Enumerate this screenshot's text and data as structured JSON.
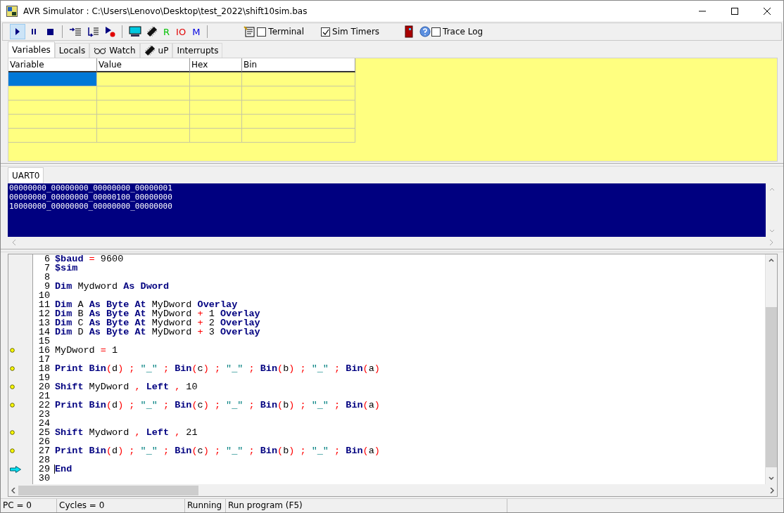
{
  "window": {
    "title": "AVR Simulator : C:\\Users\\Lenovo\\Desktop\\test_2022\\shift10sim.bas"
  },
  "toolbar": {
    "run_selected": true,
    "text_buttons": [
      {
        "label": "R",
        "color": "#00c000"
      },
      {
        "label": "IO",
        "color": "#e00000"
      },
      {
        "label": "M",
        "color": "#0000e0"
      }
    ],
    "checkboxes": [
      {
        "label": "Terminal",
        "checked": false
      },
      {
        "label": "Sim Timers",
        "checked": true
      },
      {
        "label": "Trace Log",
        "checked": false
      }
    ]
  },
  "tabs": [
    {
      "label": "Variables",
      "selected": true,
      "kind": "plain"
    },
    {
      "label": "Locals",
      "selected": false,
      "kind": "plain"
    },
    {
      "label": "Watch",
      "selected": false,
      "kind": "glasses"
    },
    {
      "label": "uP",
      "selected": false,
      "kind": "chip"
    },
    {
      "label": "Interrupts",
      "selected": false,
      "kind": "plain"
    }
  ],
  "variables_table": {
    "columns": [
      "Variable",
      "Value",
      "Hex",
      "Bin"
    ],
    "rows": [
      {
        "selected": true
      },
      {
        "selected": false
      },
      {
        "selected": false
      },
      {
        "selected": false
      },
      {
        "selected": false
      }
    ]
  },
  "uart_tabs": [
    {
      "label": "UART0",
      "selected": true
    }
  ],
  "uart_output": [
    "00000000_00000000_00000000_00000001",
    "00000000_00000000_00000100_00000000",
    "10000000_00000000_00000000_00000000"
  ],
  "code_lines": [
    {
      "number": "6",
      "kind": "plain",
      "tokens": [
        {
          "kind": "kw",
          "text": "$baud"
        },
        {
          "kind": "op",
          "text": " = "
        },
        {
          "kind": "id",
          "text": "9600"
        }
      ]
    },
    {
      "number": "7",
      "kind": "plain",
      "tokens": [
        {
          "kind": "kw",
          "text": "$sim"
        }
      ]
    },
    {
      "number": "8",
      "kind": "plain"
    },
    {
      "number": "9",
      "kind": "plain",
      "tokens": [
        {
          "kind": "kw",
          "text": "Dim"
        },
        {
          "kind": "id",
          "text": " Mydword "
        },
        {
          "kind": "kw",
          "text": "As Dword"
        }
      ]
    },
    {
      "number": "10",
      "kind": "plain"
    },
    {
      "number": "11",
      "kind": "plain",
      "tokens": [
        {
          "kind": "kw",
          "text": "Dim"
        },
        {
          "kind": "id",
          "text": " A "
        },
        {
          "kind": "kw",
          "text": "As Byte At"
        },
        {
          "kind": "id",
          "text": " MyDword "
        },
        {
          "kind": "kw",
          "text": "Overlay"
        }
      ]
    },
    {
      "number": "12",
      "kind": "plain",
      "tokens": [
        {
          "kind": "kw",
          "text": "Dim"
        },
        {
          "kind": "id",
          "text": " B "
        },
        {
          "kind": "kw",
          "text": "As Byte At"
        },
        {
          "kind": "id",
          "text": " MyDword "
        },
        {
          "kind": "op",
          "text": "+"
        },
        {
          "kind": "id",
          "text": " 1 "
        },
        {
          "kind": "kw",
          "text": "Overlay"
        }
      ]
    },
    {
      "number": "13",
      "kind": "plain",
      "tokens": [
        {
          "kind": "kw",
          "text": "Dim"
        },
        {
          "kind": "id",
          "text": " C "
        },
        {
          "kind": "kw",
          "text": "As Byte At"
        },
        {
          "kind": "id",
          "text": " Mydword "
        },
        {
          "kind": "op",
          "text": "+"
        },
        {
          "kind": "id",
          "text": " 2 "
        },
        {
          "kind": "kw",
          "text": "Overlay"
        }
      ]
    },
    {
      "number": "14",
      "kind": "plain",
      "tokens": [
        {
          "kind": "kw",
          "text": "Dim"
        },
        {
          "kind": "id",
          "text": " D "
        },
        {
          "kind": "kw",
          "text": "As Byte At"
        },
        {
          "kind": "id",
          "text": " MyDword "
        },
        {
          "kind": "op",
          "text": "+"
        },
        {
          "kind": "id",
          "text": " 3 "
        },
        {
          "kind": "kw",
          "text": "Overlay"
        }
      ]
    },
    {
      "number": "15",
      "kind": "plain"
    },
    {
      "number": "16",
      "kind": "dot",
      "tokens": [
        {
          "kind": "id",
          "text": "MyDword"
        },
        {
          "kind": "op",
          "text": " = "
        },
        {
          "kind": "id",
          "text": "1"
        }
      ]
    },
    {
      "number": "17",
      "kind": "plain"
    },
    {
      "number": "18",
      "kind": "dot",
      "tokens": [
        {
          "kind": "kw",
          "text": "Print Bin"
        },
        {
          "kind": "op",
          "text": "("
        },
        {
          "kind": "id",
          "text": "d"
        },
        {
          "kind": "op",
          "text": ") ; "
        },
        {
          "kind": "str",
          "text": "\"_\""
        },
        {
          "kind": "op",
          "text": " ; "
        },
        {
          "kind": "kw",
          "text": "Bin"
        },
        {
          "kind": "op",
          "text": "("
        },
        {
          "kind": "id",
          "text": "c"
        },
        {
          "kind": "op",
          "text": ") ; "
        },
        {
          "kind": "str",
          "text": "\"_\""
        },
        {
          "kind": "op",
          "text": " ; "
        },
        {
          "kind": "kw",
          "text": "Bin"
        },
        {
          "kind": "op",
          "text": "("
        },
        {
          "kind": "id",
          "text": "b"
        },
        {
          "kind": "op",
          "text": ") ; "
        },
        {
          "kind": "str",
          "text": "\"_\""
        },
        {
          "kind": "op",
          "text": " ; "
        },
        {
          "kind": "kw",
          "text": "Bin"
        },
        {
          "kind": "op",
          "text": "("
        },
        {
          "kind": "id",
          "text": "a"
        },
        {
          "kind": "op",
          "text": ")"
        }
      ]
    },
    {
      "number": "19",
      "kind": "plain"
    },
    {
      "number": "20",
      "kind": "dot",
      "tokens": [
        {
          "kind": "kw",
          "text": "Shift"
        },
        {
          "kind": "id",
          "text": " MyDword "
        },
        {
          "kind": "op",
          "text": ", "
        },
        {
          "kind": "kw",
          "text": "Left"
        },
        {
          "kind": "op",
          "text": " , "
        },
        {
          "kind": "id",
          "text": "10"
        }
      ]
    },
    {
      "number": "21",
      "kind": "plain"
    },
    {
      "number": "22",
      "kind": "dot",
      "tokens": [
        {
          "kind": "kw",
          "text": "Print Bin"
        },
        {
          "kind": "op",
          "text": "("
        },
        {
          "kind": "id",
          "text": "d"
        },
        {
          "kind": "op",
          "text": ") ; "
        },
        {
          "kind": "str",
          "text": "\"_\""
        },
        {
          "kind": "op",
          "text": " ; "
        },
        {
          "kind": "kw",
          "text": "Bin"
        },
        {
          "kind": "op",
          "text": "("
        },
        {
          "kind": "id",
          "text": "c"
        },
        {
          "kind": "op",
          "text": ") ; "
        },
        {
          "kind": "str",
          "text": "\"_\""
        },
        {
          "kind": "op",
          "text": " ; "
        },
        {
          "kind": "kw",
          "text": "Bin"
        },
        {
          "kind": "op",
          "text": "("
        },
        {
          "kind": "id",
          "text": "b"
        },
        {
          "kind": "op",
          "text": ") ; "
        },
        {
          "kind": "str",
          "text": "\"_\""
        },
        {
          "kind": "op",
          "text": " ; "
        },
        {
          "kind": "kw",
          "text": "Bin"
        },
        {
          "kind": "op",
          "text": "("
        },
        {
          "kind": "id",
          "text": "a"
        },
        {
          "kind": "op",
          "text": ")"
        }
      ]
    },
    {
      "number": "23",
      "kind": "plain"
    },
    {
      "number": "24",
      "kind": "plain"
    },
    {
      "number": "25",
      "kind": "dot",
      "tokens": [
        {
          "kind": "kw",
          "text": "Shift"
        },
        {
          "kind": "id",
          "text": " Mydword "
        },
        {
          "kind": "op",
          "text": ", "
        },
        {
          "kind": "kw",
          "text": "Left"
        },
        {
          "kind": "op",
          "text": " , "
        },
        {
          "kind": "id",
          "text": "21"
        }
      ]
    },
    {
      "number": "26",
      "kind": "plain"
    },
    {
      "number": "27",
      "kind": "dot",
      "tokens": [
        {
          "kind": "kw",
          "text": "Print Bin"
        },
        {
          "kind": "op",
          "text": "("
        },
        {
          "kind": "id",
          "text": "d"
        },
        {
          "kind": "op",
          "text": ") ; "
        },
        {
          "kind": "str",
          "text": "\"_\""
        },
        {
          "kind": "op",
          "text": " ; "
        },
        {
          "kind": "kw",
          "text": "Bin"
        },
        {
          "kind": "op",
          "text": "("
        },
        {
          "kind": "id",
          "text": "c"
        },
        {
          "kind": "op",
          "text": ") ; "
        },
        {
          "kind": "str",
          "text": "\"_\""
        },
        {
          "kind": "op",
          "text": " ; "
        },
        {
          "kind": "kw",
          "text": "Bin"
        },
        {
          "kind": "op",
          "text": "("
        },
        {
          "kind": "id",
          "text": "b"
        },
        {
          "kind": "op",
          "text": ") ; "
        },
        {
          "kind": "str",
          "text": "\"_\""
        },
        {
          "kind": "op",
          "text": " ; "
        },
        {
          "kind": "kw",
          "text": "Bin"
        },
        {
          "kind": "op",
          "text": "("
        },
        {
          "kind": "id",
          "text": "a"
        },
        {
          "kind": "op",
          "text": ")"
        }
      ]
    },
    {
      "number": "28",
      "kind": "plain"
    },
    {
      "number": "29",
      "kind": "current",
      "tokens": [
        {
          "kind": "kw",
          "text": "End"
        }
      ]
    },
    {
      "number": "30",
      "kind": "plain"
    }
  ],
  "status_bar": [
    "PC = 0",
    "Cycles = 0",
    "Running",
    "Run program (F5)"
  ]
}
